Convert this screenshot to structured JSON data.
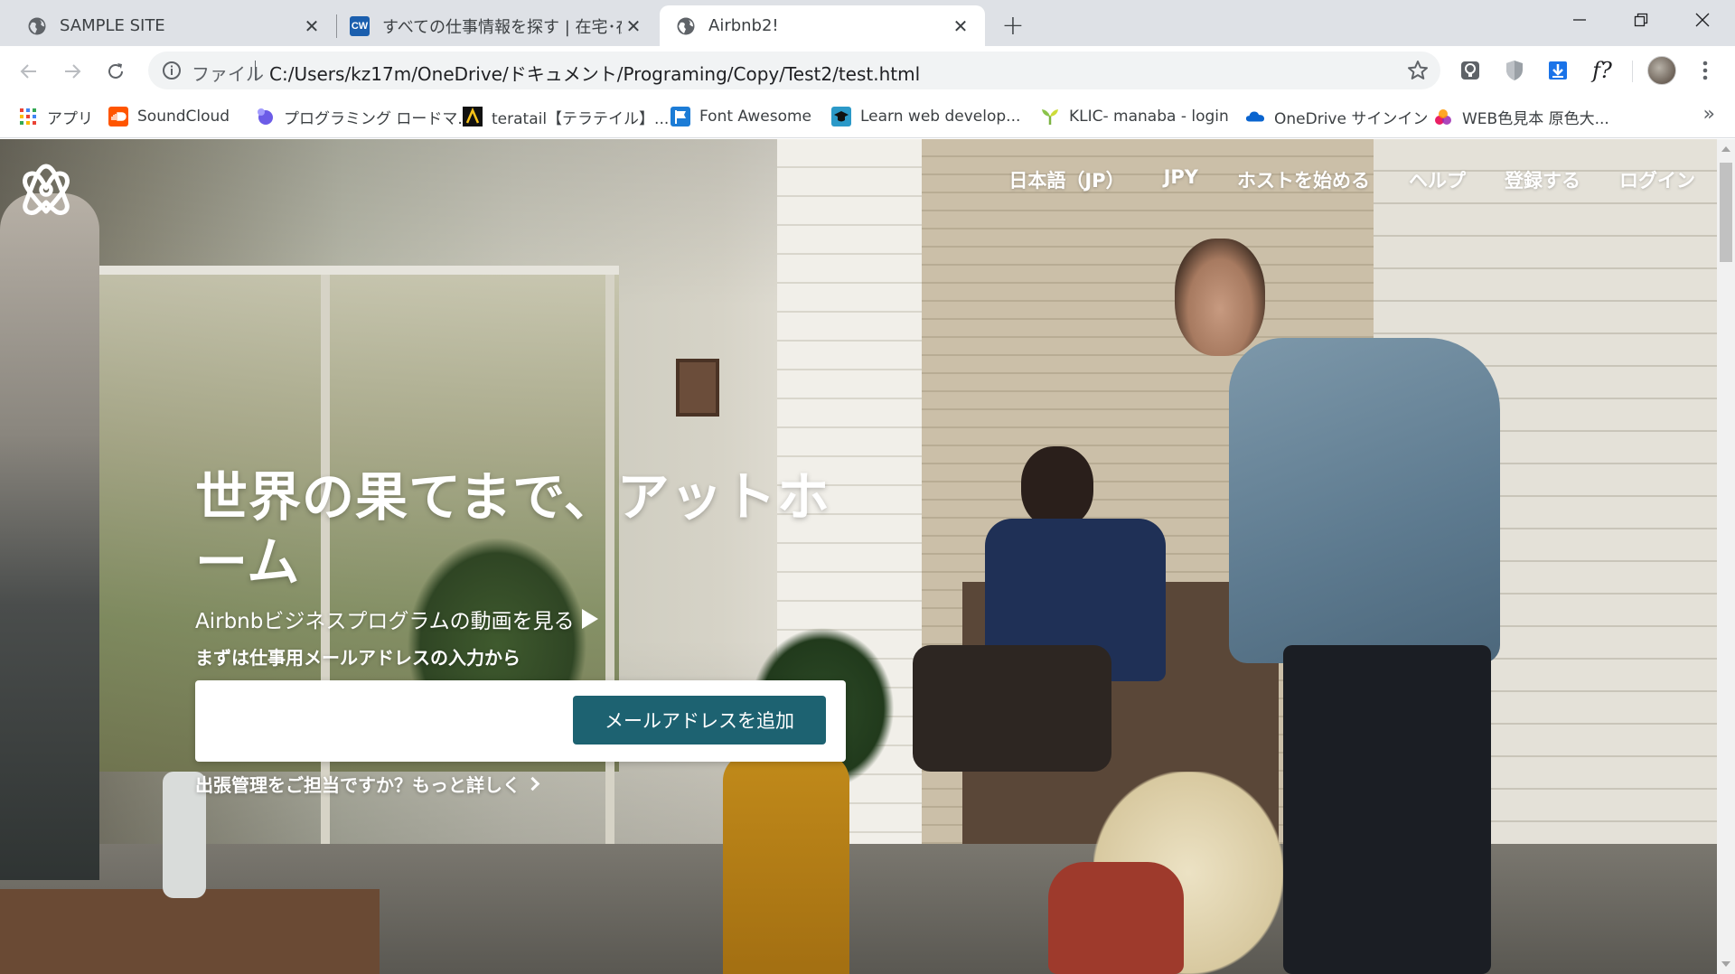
{
  "browser": {
    "tabs": [
      {
        "title": "SAMPLE SITE",
        "icon": "globe-icon",
        "active": false
      },
      {
        "title": "すべての仕事情報を探す | 在宅･在宅",
        "icon": "cw-icon",
        "badge": "CW",
        "active": false
      },
      {
        "title": "Airbnb2!",
        "icon": "globe-icon",
        "active": true
      }
    ],
    "close_glyph": "✕",
    "new_tab_glyph": "+",
    "window_controls": {
      "minimize": "minimize-icon",
      "maximize": "restore-icon",
      "close": "close-icon"
    },
    "omnibox": {
      "scheme_label": "ファイル",
      "url": "C:/Users/kz17m/OneDrive/ドキュメント/Programing/Copy/Test2/test.html"
    },
    "extensions_glyph": "f?",
    "bookmarks": [
      {
        "label": "アプリ",
        "icon": "apps-grid-icon"
      },
      {
        "label": "SoundCloud",
        "icon": "soundcloud-icon"
      },
      {
        "label": "プログラミング ロードマ...",
        "icon": "roadmap-icon"
      },
      {
        "label": "teratail【テラテイル】...",
        "icon": "teratail-icon"
      },
      {
        "label": "Font Awesome",
        "icon": "flag-icon"
      },
      {
        "label": "Learn web develop...",
        "icon": "learn-icon"
      },
      {
        "label": "KLIC- manaba - login",
        "icon": "manaba-icon"
      },
      {
        "label": "OneDrive サインイン",
        "icon": "onedrive-icon"
      },
      {
        "label": "WEB色見本 原色大...",
        "icon": "color-icon"
      }
    ],
    "bookmarks_more": "»"
  },
  "site": {
    "nav": [
      "日本語（JP）",
      "JPY",
      "ホストを始める",
      "ヘルプ",
      "登録する",
      "ログイン"
    ],
    "hero": {
      "title": "世界の果てまで、アットホーム",
      "video_link": "Airbnbビジネスプログラムの動画を見る",
      "subtitle": "まずは仕事用メールアドレスの入力から",
      "email_placeholder": "",
      "button_label": "メールアドレスを追加",
      "more_link": "出張管理をご担当ですか？もっと詳しく"
    },
    "colors": {
      "button": "#1d6271",
      "text": "#ffffff"
    }
  }
}
